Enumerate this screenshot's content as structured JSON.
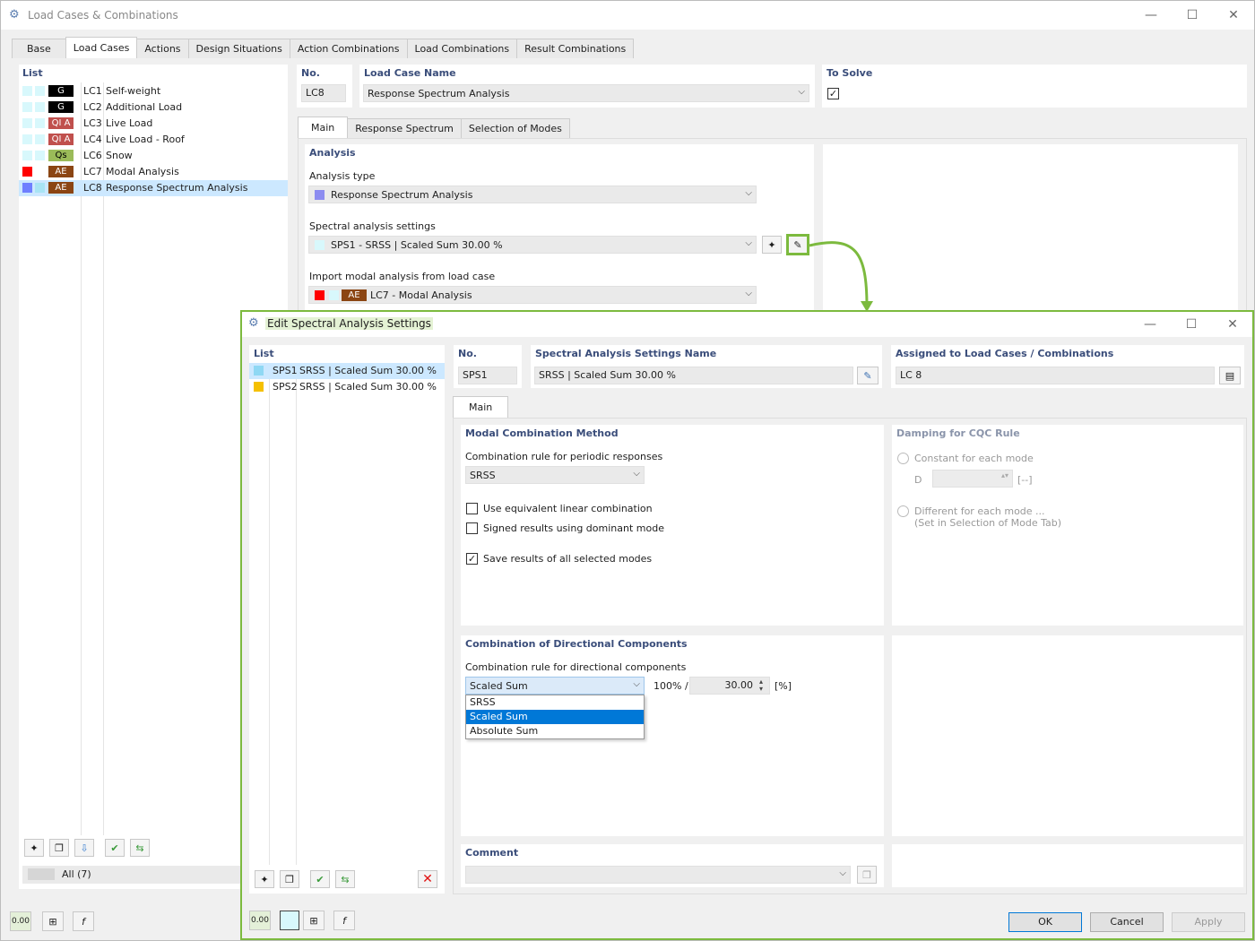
{
  "main_window": {
    "title": "Load Cases & Combinations",
    "tabs": [
      "Base",
      "Load Cases",
      "Actions",
      "Design Situations",
      "Action Combinations",
      "Load Combinations",
      "Result Combinations"
    ],
    "list": {
      "title": "List",
      "items": [
        {
          "tag": "G",
          "tag_bg": "#000000",
          "tag_fg": "#ffffff",
          "sq1": "#d8f8fc",
          "sq2": "#d8f8fc",
          "id": "LC1",
          "name": "Self-weight"
        },
        {
          "tag": "G",
          "tag_bg": "#000000",
          "tag_fg": "#ffffff",
          "sq1": "#d8f8fc",
          "sq2": "#d8f8fc",
          "id": "LC2",
          "name": "Additional Load"
        },
        {
          "tag": "QI A",
          "tag_bg": "#c0504d",
          "tag_fg": "#ffffff",
          "sq1": "#d8f8fc",
          "sq2": "#d8f8fc",
          "id": "LC3",
          "name": "Live Load"
        },
        {
          "tag": "QI A",
          "tag_bg": "#c0504d",
          "tag_fg": "#ffffff",
          "sq1": "#d8f8fc",
          "sq2": "#d8f8fc",
          "id": "LC4",
          "name": "Live Load - Roof"
        },
        {
          "tag": "Qs",
          "tag_bg": "#9bbb59",
          "tag_fg": "#000000",
          "sq1": "#d8f8fc",
          "sq2": "#d8f8fc",
          "id": "LC6",
          "name": "Snow"
        },
        {
          "tag": "AE",
          "tag_bg": "#8b4513",
          "tag_fg": "#ffffff",
          "sq1": "#ff0000",
          "sq2": "#ffffff",
          "id": "LC7",
          "name": "Modal Analysis"
        },
        {
          "tag": "AE",
          "tag_bg": "#8b4513",
          "tag_fg": "#ffffff",
          "sq1": "#6f7fff",
          "sq2": "#a8e4f4",
          "id": "LC8",
          "name": "Response Spectrum Analysis"
        }
      ],
      "filter": "All (7)"
    },
    "no_label": "No.",
    "no_value": "LC8",
    "name_label": "Load Case Name",
    "name_value": "Response Spectrum Analysis",
    "to_solve_label": "To Solve",
    "inner_tabs": [
      "Main",
      "Response Spectrum",
      "Selection of Modes"
    ],
    "analysis": {
      "title": "Analysis",
      "type_label": "Analysis type",
      "type_value": "Response Spectrum Analysis",
      "spectral_label": "Spectral analysis settings",
      "spectral_value": "SPS1 - SRSS | Scaled Sum 30.00 %",
      "import_label": "Import modal analysis from load case",
      "import_tag": "AE",
      "import_value": "LC7 - Modal Analysis"
    },
    "bottom_value": "0.00"
  },
  "dialog": {
    "title": "Edit Spectral Analysis Settings",
    "list": {
      "title": "List",
      "items": [
        {
          "color": "#8fd8f4",
          "id": "SPS1",
          "name": "SRSS | Scaled Sum 30.00 %"
        },
        {
          "color": "#f5c000",
          "id": "SPS2",
          "name": "SRSS | Scaled Sum 30.00 %"
        }
      ]
    },
    "no_label": "No.",
    "no_value": "SPS1",
    "name_label": "Spectral Analysis Settings Name",
    "name_value": "SRSS | Scaled Sum 30.00 %",
    "assigned_label": "Assigned to Load Cases / Combinations",
    "assigned_value": "LC 8",
    "tab": "Main",
    "modal": {
      "title": "Modal Combination Method",
      "rule_label": "Combination rule for periodic responses",
      "rule_value": "SRSS",
      "opt1": "Use equivalent linear combination",
      "opt2": "Signed results using dominant mode",
      "opt3": "Save results of all selected modes"
    },
    "damping": {
      "title": "Damping for CQC Rule",
      "opt1": "Constant for each mode",
      "d_label": "D",
      "d_unit": "[--]",
      "opt2": "Different for each mode ...",
      "opt2_note": "(Set in Selection of Mode Tab)"
    },
    "directional": {
      "title": "Combination of Directional Components",
      "rule_label": "Combination rule for directional components",
      "rule_value": "Scaled Sum",
      "pct_label": "100% /",
      "pct_value": "30.00",
      "unit": "[%]",
      "options": [
        "SRSS",
        "Scaled Sum",
        "Absolute Sum"
      ],
      "selected_option": "Scaled Sum"
    },
    "comment_label": "Comment",
    "bottom_value": "0.00",
    "ok": "OK",
    "cancel": "Cancel",
    "apply": "Apply"
  }
}
